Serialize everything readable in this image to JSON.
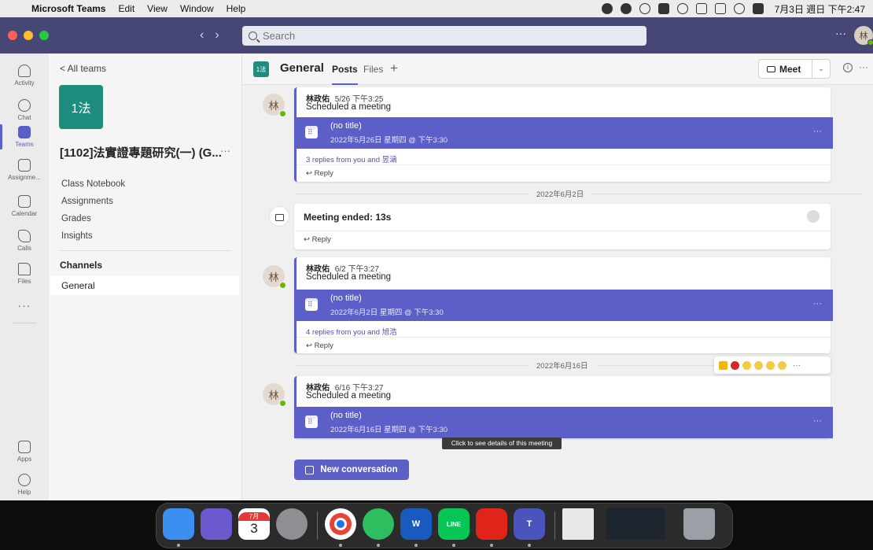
{
  "menubar": {
    "app_name": "Microsoft Teams",
    "menus": [
      "Edit",
      "View",
      "Window",
      "Help"
    ],
    "clock": "7月3日 週日 下午2:47"
  },
  "titlebar": {
    "search_placeholder": "Search",
    "more": "···",
    "avatar_initial": "林"
  },
  "rail": {
    "items": [
      {
        "label": "Activity",
        "icon": "bell-icon"
      },
      {
        "label": "Chat",
        "icon": "chat-icon"
      },
      {
        "label": "Teams",
        "icon": "teams-icon",
        "active": true
      },
      {
        "label": "Assignme...",
        "icon": "assignments-icon"
      },
      {
        "label": "Calendar",
        "icon": "calendar-icon"
      },
      {
        "label": "Calls",
        "icon": "phone-icon"
      },
      {
        "label": "Files",
        "icon": "file-icon"
      }
    ],
    "more": "···",
    "apps_label": "Apps",
    "help_label": "Help"
  },
  "team_panel": {
    "back_label": "< All teams",
    "team_avatar": "1法",
    "team_name": "[1102]法實證專題研究(一) (G...",
    "team_more": "···",
    "links": [
      "Class Notebook",
      "Assignments",
      "Grades",
      "Insights"
    ],
    "channels_heading": "Channels",
    "channels": [
      "General"
    ]
  },
  "channel_header": {
    "avatar": "1法",
    "title": "General",
    "tabs": [
      "Posts",
      "Files"
    ],
    "add_tab": "+",
    "meet_label": "Meet",
    "meet_caret": "⌄",
    "info": "i",
    "more": "···"
  },
  "feed": {
    "posts": [
      {
        "author": "林政佑",
        "time": "5/26 下午3:25",
        "subtitle": "Scheduled a meeting",
        "meeting_title": "(no title)",
        "meeting_when": "2022年5月26日 星期四 @ 下午3:30",
        "replies": "3 replies from you and 昱涵",
        "reply_label": "↩ Reply"
      },
      {
        "author": "林政佑",
        "time": "6/2 下午3:27",
        "subtitle": "Scheduled a meeting",
        "meeting_title": "(no title)",
        "meeting_when": "2022年6月2日 星期四 @ 下午3:30",
        "replies": "4 replies from you and 旭浩",
        "reply_label": "↩ Reply"
      },
      {
        "author": "林政佑",
        "time": "6/16 下午3:27",
        "subtitle": "Scheduled a meeting",
        "meeting_title": "(no title)",
        "meeting_when": "2022年6月16日 星期四 @ 下午3:30"
      }
    ],
    "date_separators": [
      "2022年6月2日",
      "2022年6月16日"
    ],
    "meeting_ended": {
      "title": "Meeting ended: 13s",
      "reply_label": "↩ Reply"
    },
    "avatar_initial": "林",
    "tooltip": "Click to see details of this meeting",
    "new_conversation": "New conversation",
    "meeting_more": "···",
    "reactions_more": "···"
  },
  "dock": {
    "calendar_month": "7月",
    "calendar_day": "3",
    "word_letter": "W",
    "line_label": "LINE",
    "teams_letter": "T"
  }
}
